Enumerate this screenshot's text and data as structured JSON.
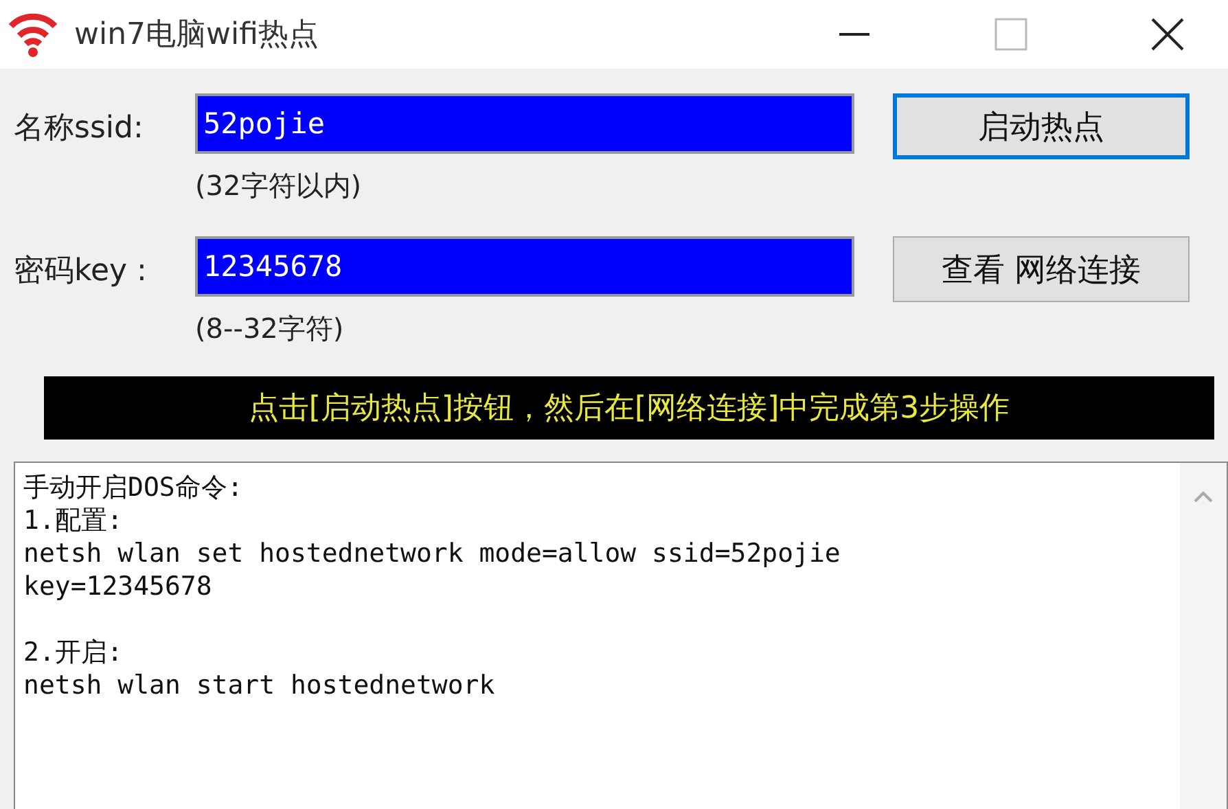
{
  "window": {
    "title": "win7电脑wifi热点"
  },
  "fields": [
    {
      "label": "名称ssid:",
      "value": "52pojie",
      "hint": "(32字符以内)",
      "button": {
        "label": "启动热点",
        "focused": true
      }
    },
    {
      "label": "密码key :",
      "value": "12345678",
      "hint": "(8--32字符)",
      "button": {
        "label": "查看 网络连接",
        "focused": false
      }
    }
  ],
  "banner": "点击[启动热点]按钮，然后在[网络连接]中完成第3步操作",
  "commands": [
    [
      "手动开启DOS命令:",
      "1.配置:",
      "netsh wlan set hostednetwork mode=allow ssid=52pojie",
      "key=12345678"
    ],
    [
      "2.开启:",
      "netsh wlan start hostednetwork"
    ]
  ]
}
